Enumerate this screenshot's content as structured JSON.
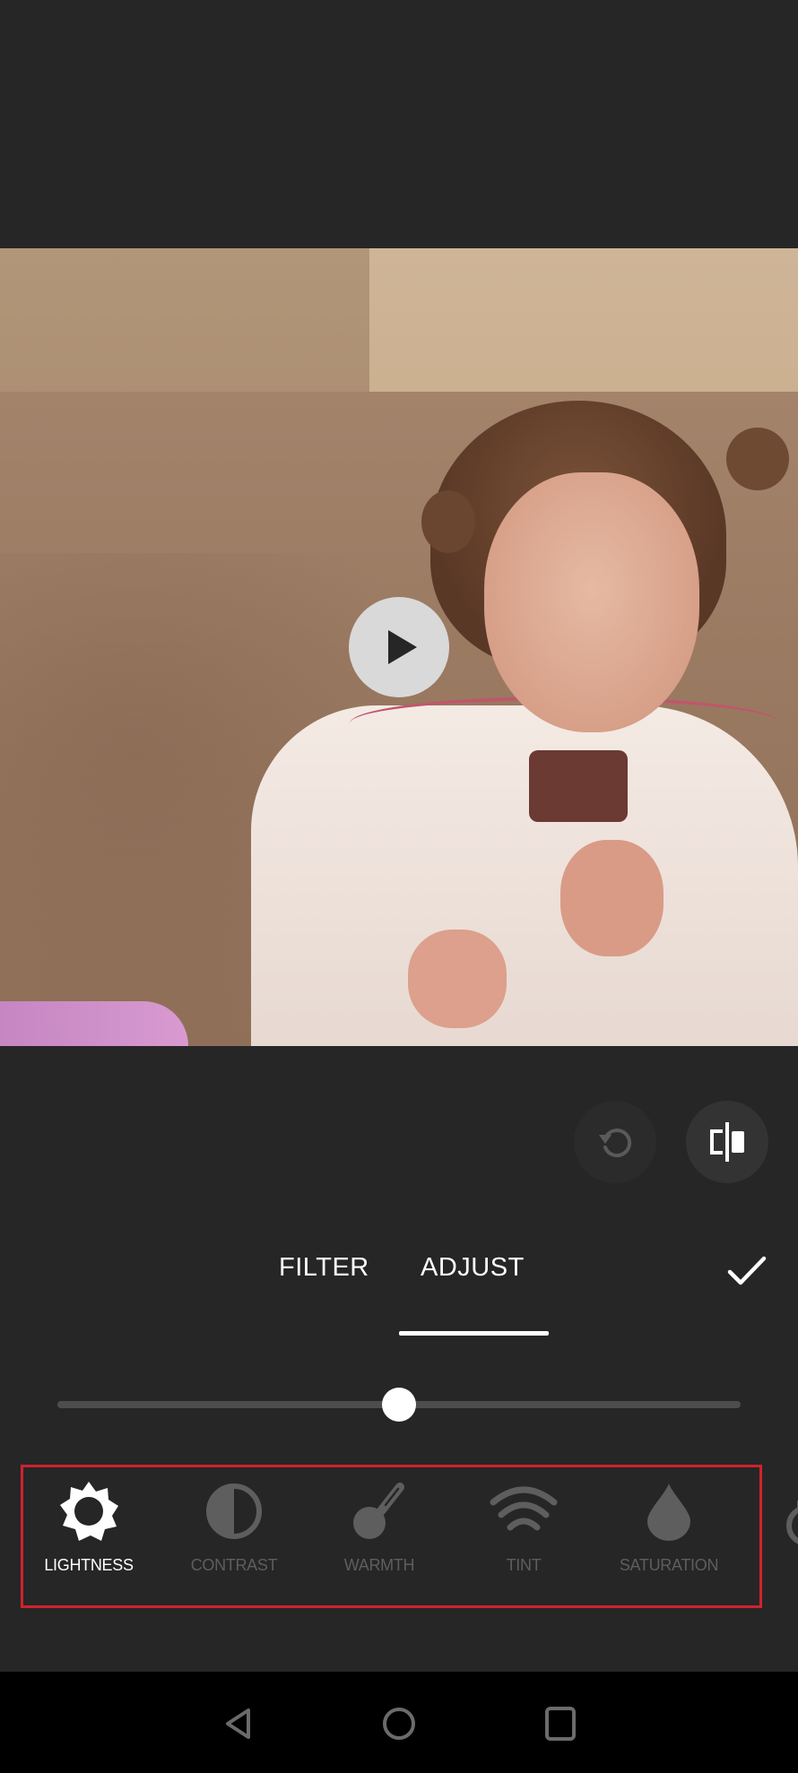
{
  "video": {
    "play_icon": "play-icon",
    "state": "paused"
  },
  "actions": {
    "reset_icon": "reset-icon",
    "compare_icon": "compare-icon",
    "confirm_icon": "checkmark-icon"
  },
  "tabs": [
    {
      "label": "FILTER",
      "active": false
    },
    {
      "label": "ADJUST",
      "active": true
    }
  ],
  "slider": {
    "value_fraction": 0.5
  },
  "tools": [
    {
      "label": "LIGHTNESS",
      "icon": "sun-icon",
      "active": true
    },
    {
      "label": "CONTRAST",
      "icon": "contrast-icon",
      "active": false
    },
    {
      "label": "WARMTH",
      "icon": "thermometer-icon",
      "active": false
    },
    {
      "label": "TINT",
      "icon": "wifi-waves-icon",
      "active": false
    },
    {
      "label": "SATURATION",
      "icon": "droplet-icon",
      "active": false
    }
  ],
  "colors": {
    "background": "#262626",
    "active": "#ffffff",
    "inactive": "#5e5e5e",
    "highlight_outline": "#d0222e"
  },
  "system_nav": {
    "back_icon": "back-triangle-icon",
    "home_icon": "home-circle-icon",
    "recents_icon": "recents-square-icon"
  }
}
